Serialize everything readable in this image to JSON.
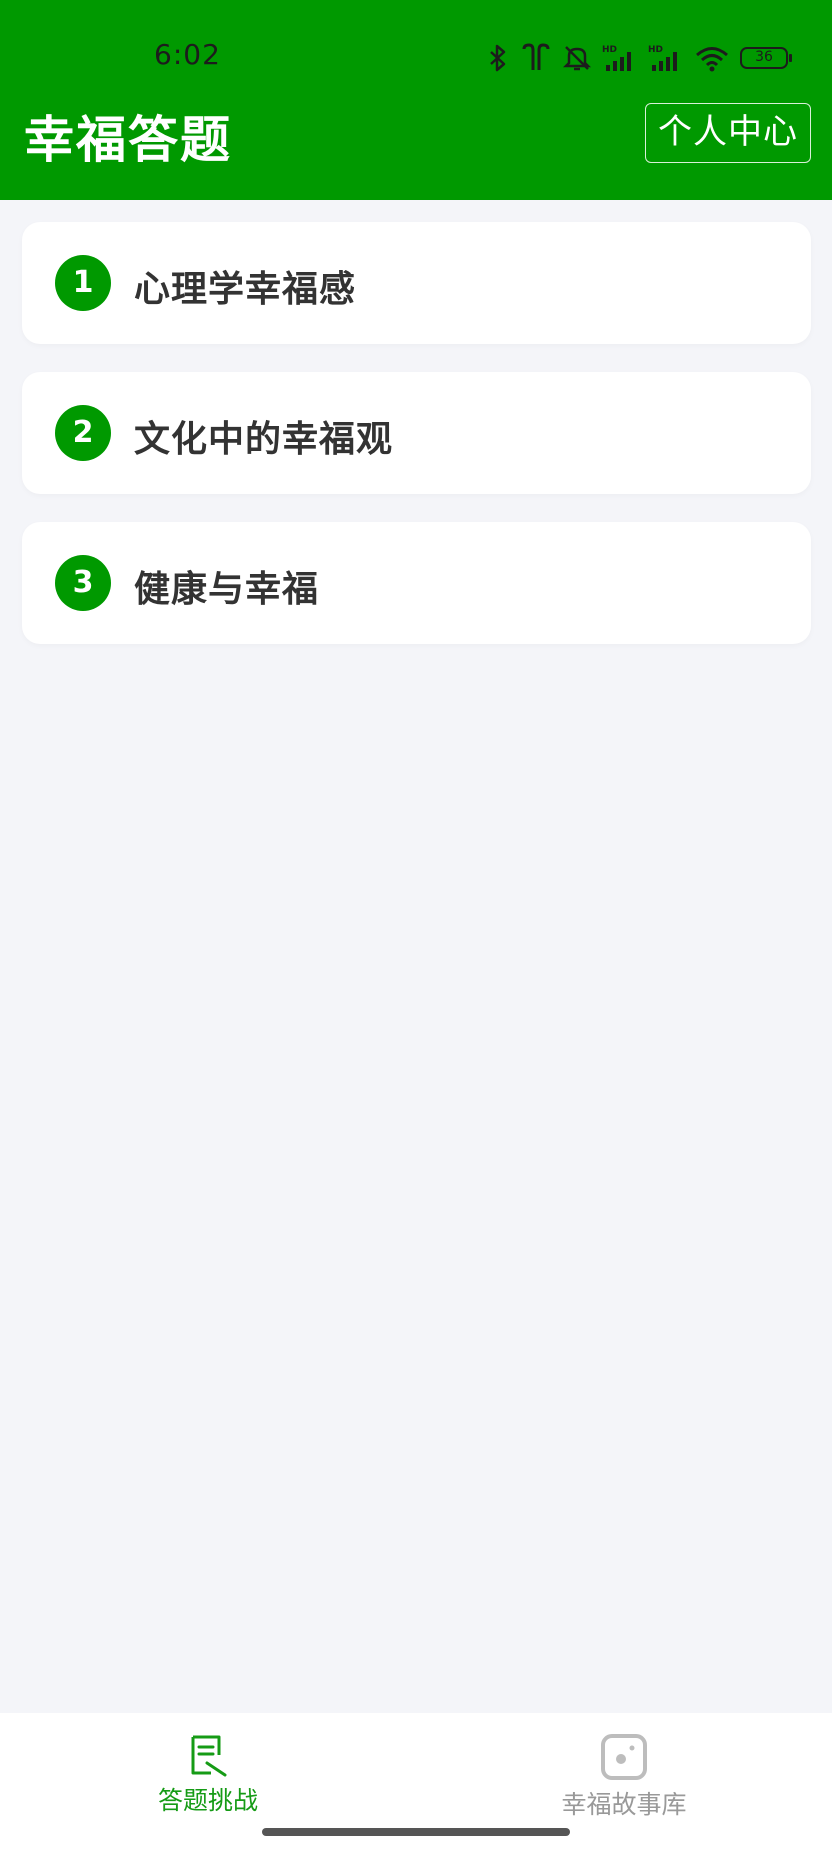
{
  "status_bar": {
    "time": "6:02",
    "battery": "36",
    "icons": [
      "bluetooth-icon",
      "earbuds-icon",
      "mute-icon",
      "signal-hd-icon",
      "signal-hd-icon",
      "wifi-icon",
      "battery-icon"
    ]
  },
  "header": {
    "title": "幸福答题",
    "profile_button": "个人中心",
    "background_color": "#009900"
  },
  "topics": [
    {
      "number": "1",
      "title": "心理学幸福感"
    },
    {
      "number": "2",
      "title": "文化中的幸福观"
    },
    {
      "number": "3",
      "title": "健康与幸福"
    }
  ],
  "tab_bar": {
    "tabs": [
      {
        "label": "答题挑战",
        "icon": "quiz-icon",
        "active": true
      },
      {
        "label": "幸福故事库",
        "icon": "story-library-icon",
        "active": false
      }
    ],
    "active_color": "#159b15",
    "inactive_color": "#999999"
  }
}
